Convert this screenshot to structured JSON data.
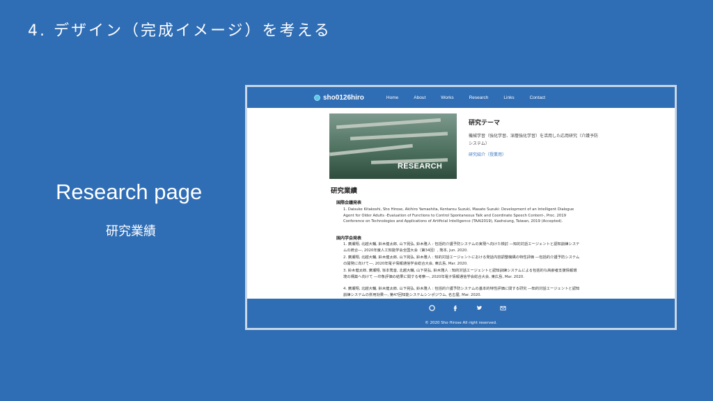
{
  "slide": {
    "title": "4. デザイン（完成イメージ）を考える",
    "left_title": "Research page",
    "left_subtitle": "研究業績"
  },
  "site": {
    "brand": "sho0126hiro",
    "nav": [
      "Home",
      "About",
      "Works",
      "Research",
      "Links",
      "Contact"
    ],
    "hero_label": "RESEARCH",
    "theme_title": "研究テーマ",
    "theme_desc": "機械学習（強化学習、深層強化学習）を活用した応用研究（介護予防システム）",
    "theme_link": "研究紹介（授業用）",
    "achievements_title": "研究業績",
    "intl_title": "国際会議発表",
    "intl_entries": [
      "1. Daisuke Kitakoshi, Sho Hirose, Akihiro Yamashita, Kentarou Suzuki, Masato Suzuki: Development of an Intelligent Dialogue Agent for Older Adults -Evaluation of Functions to Control Spontaneous Talk and Coordinate Speech Content-, Proc. 2019 Conference on Technologies and Applications of Artificial Intelligence (TAAI2019), Kaohsiung, Taiwan, 2019 (Accepted)."
    ],
    "domestic_title": "国内学会発表",
    "domestic_entries": [
      "1. 廣瀬翔, 北越大輔, 鈴木健太郎, 山下晃弘, 鈴木雅人 : 包括的介護予防システムの実現へ向けた検討 ―知的対話エージェントと認知訓練システムの統合―, 2020年度人工知能学会全国大会（第34回）, 熊本, Jun. 2020.",
      "2. 廣瀬翔, 北越大輔, 鈴木健太郎, 山下晃弘, 鈴木雅人 : 知的対話エージェントにおける発話内容調整機構の特性評価 ―包括的介護予防システムの開発に向けて―, 2020年電子情報通信学会総合大会, 東広島, Mar. 2020.",
      "3. 鈴木健太郎, 廣瀬翔, 坂本篤音, 北越大輔, 山下晃弘, 鈴木雅人 : 知的対話エージェントと認知訓練システムによる包括的な高齢者支援情報環境の構築へ向けて ―印象評価の結果に関する考察―, 2020年電子情報通信学会総合大会, 東広島, Mar. 2020.",
      "4. 廣瀬翔, 北越大輔, 鈴木健太郎, 山下晃弘, 鈴木雅人 : 包括的介護予防システムの基本的特性評価に関する研究 ―知的対話エージェントと認知訓練システムの併用効果―, 第47回知能システムシンポジウム, 名古屋, Mar. 2020."
    ],
    "footer_icons": [
      "github-icon",
      "facebook-icon",
      "twitter-icon",
      "mail-icon"
    ],
    "copyright": "© 2020 Sho Hirose All right reserved."
  }
}
